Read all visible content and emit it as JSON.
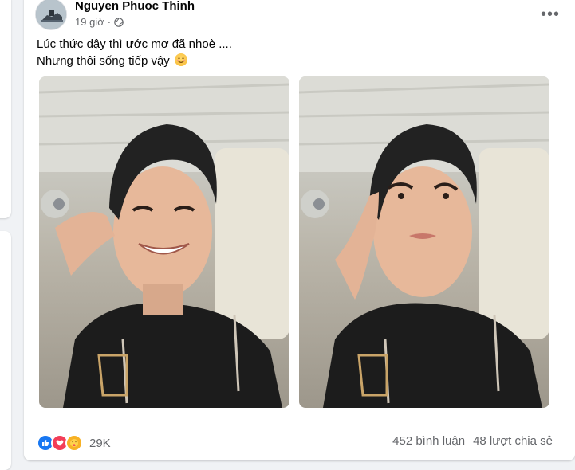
{
  "post": {
    "author": "Nguyen Phuoc Thinh",
    "time": "19 giờ",
    "privacy_icon": "globe-icon",
    "text_lines": [
      "Lúc thức dậy thì ước mơ đã nhoè ....",
      "Nhưng thôi sống tiếp vậy"
    ],
    "text_emoji": "smiling-face-emoji",
    "photos": [
      {
        "description_icon": "selfie-smiling-photo"
      },
      {
        "description_icon": "selfie-pose-photo"
      }
    ],
    "reactions": {
      "icons": [
        "like-icon",
        "love-icon",
        "care-icon"
      ],
      "count": "29K"
    },
    "comments": "452 bình luận",
    "shares": "48 lượt chia sẻ"
  },
  "colors": {
    "background": "#f0f2f5",
    "card": "#ffffff",
    "secondary_text": "#65676b",
    "like_blue": "#1877f2",
    "love_red": "#f33e58",
    "care_yellow": "#f7b125"
  }
}
